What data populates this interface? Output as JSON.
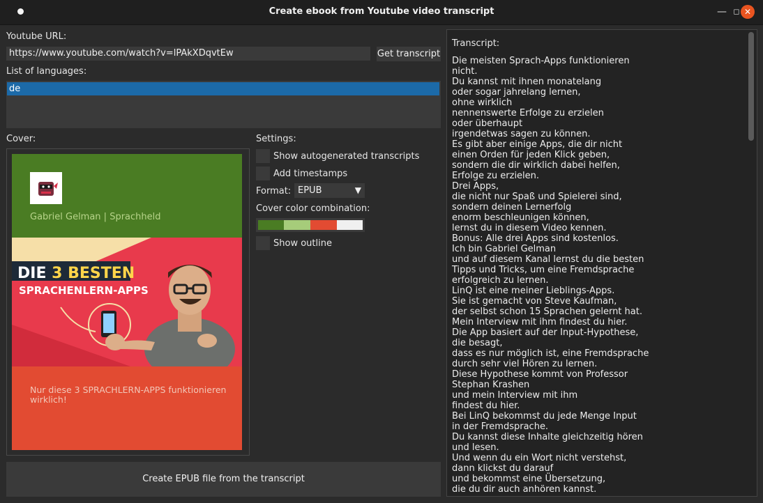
{
  "window": {
    "title": "Create ebook from Youtube video transcript"
  },
  "url_section": {
    "label": "Youtube URL:",
    "value": "https://www.youtube.com/watch?v=lPAkXDqvtEw",
    "button_label": "Get transcript"
  },
  "languages": {
    "label": "List of languages:",
    "items": [
      "de"
    ]
  },
  "cover": {
    "label": "Cover:",
    "author": "Gabriel Gelman | Sprachheld",
    "subtitle": "Nur diese 3 SPRACHLERN-APPS funktionieren wirklich!",
    "thumb_line1_a": "DIE ",
    "thumb_line1_b": "3 BESTEN",
    "thumb_line2": "SPRACHENLERN-APPS"
  },
  "settings": {
    "label": "Settings:",
    "show_autogenerated_label": "Show autogenerated transcripts",
    "add_timestamps_label": "Add timestamps",
    "format_label": "Format:",
    "format_value": "EPUB",
    "cover_color_label": "Cover color combination:",
    "cover_colors": [
      "#4a7c23",
      "#a6cc7a",
      "#e24b32",
      "#f0f0f0"
    ],
    "show_outline_label": "Show outline"
  },
  "actions": {
    "create_label": "Create EPUB file from the transcript"
  },
  "transcript": {
    "label": "Transcript:",
    "lines": [
      "Die meisten Sprach-Apps funktionieren",
      "nicht.",
      "Du kannst mit ihnen monatelang",
      "oder sogar jahrelang lernen,",
      "ohne wirklich",
      "nennenswerte Erfolge zu erzielen",
      "oder überhaupt",
      "irgendetwas sagen zu können.",
      "Es gibt aber einige Apps, die dir nicht",
      "einen Orden für jeden Klick geben,",
      "sondern die dir wirklich dabei helfen,",
      "Erfolge zu erzielen.",
      "Drei Apps,",
      "die nicht nur Spaß und Spielerei sind,",
      "sondern deinen Lernerfolg",
      "enorm beschleunigen können,",
      "lernst du in diesem Video kennen.",
      "Bonus: Alle drei Apps sind kostenlos.",
      "Ich bin Gabriel Gelman",
      "und auf diesem Kanal lernst du die besten",
      "Tipps und Tricks, um eine Fremdsprache",
      "erfolgreich zu lernen.",
      "LinQ ist eine meiner Lieblings-Apps.",
      "Sie ist gemacht von Steve Kaufman,",
      "der selbst schon 15 Sprachen gelernt hat.",
      "Mein Interview mit ihm findest du hier.",
      "Die App basiert auf der Input-Hypothese,",
      "die besagt,",
      "dass es nur möglich ist, eine Fremdsprache",
      "durch sehr viel Hören zu lernen.",
      "Diese Hypothese kommt von Professor",
      "Stephan Krashen",
      "und mein Interview mit ihm",
      "findest du hier.",
      "Bei LinQ bekommst du jede Menge Input",
      "in der Fremdsprache.",
      "Du kannst diese Inhalte gleichzeitig hören",
      "und lesen.",
      "Und wenn du ein Wort nicht verstehst,",
      "dann klickst du darauf",
      "und bekommst eine Übersetzung,",
      "die du dir auch anhören kannst."
    ]
  }
}
